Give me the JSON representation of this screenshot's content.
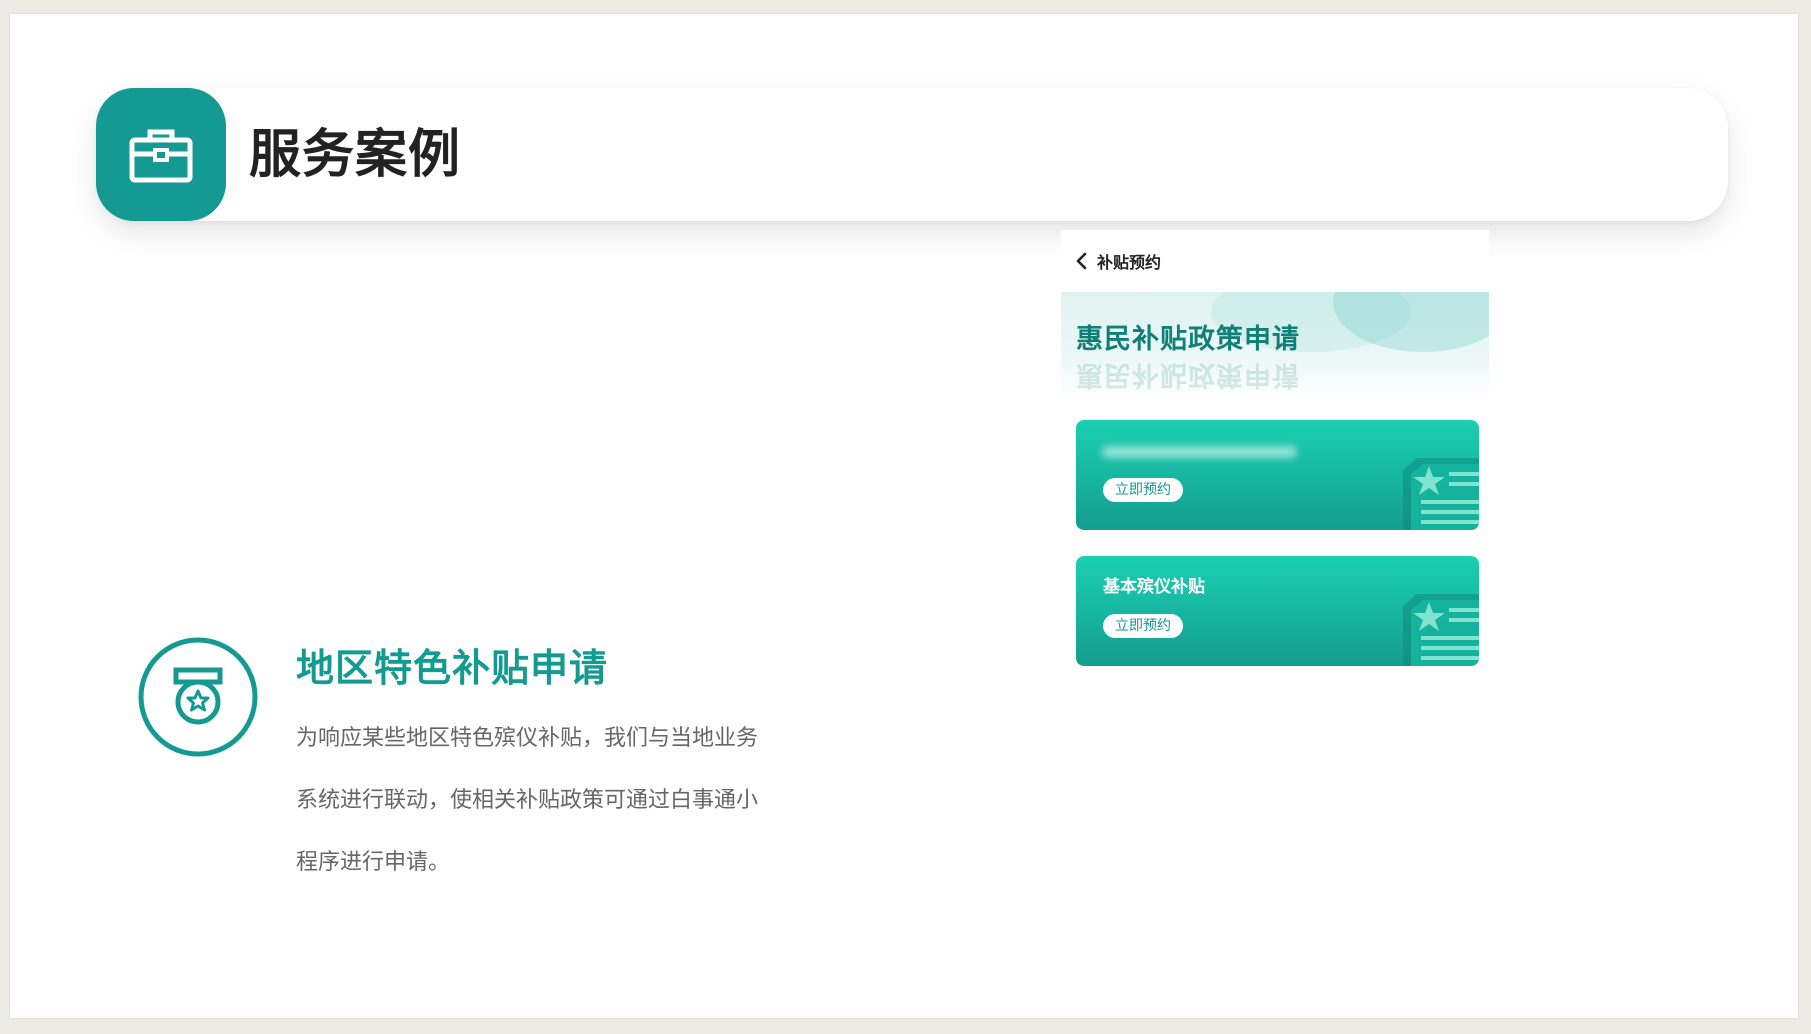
{
  "header": {
    "title": "服务案例",
    "icon": "briefcase-icon"
  },
  "feature": {
    "icon": "medal-star-icon",
    "title": "地区特色补贴申请",
    "description_lines": [
      "为响应某些地区特色殡仪补贴，我们与当地业务",
      "系统进行联动，使相关补贴政策可通过白事通小",
      "程序进行申请。"
    ]
  },
  "phone": {
    "nav_title": "补贴预约",
    "banner_title": "惠民补贴政策申请",
    "cards": [
      {
        "name": "",
        "name_blurred": true,
        "button": "立即预约"
      },
      {
        "name": "基本殡仪补贴",
        "name_blurred": false,
        "button": "立即预约"
      }
    ]
  },
  "colors": {
    "accent": "#149a92",
    "card_top": "#1bd0b1",
    "card_bottom": "#139d8f",
    "text_dark": "#222222",
    "text_muted": "#666666"
  }
}
